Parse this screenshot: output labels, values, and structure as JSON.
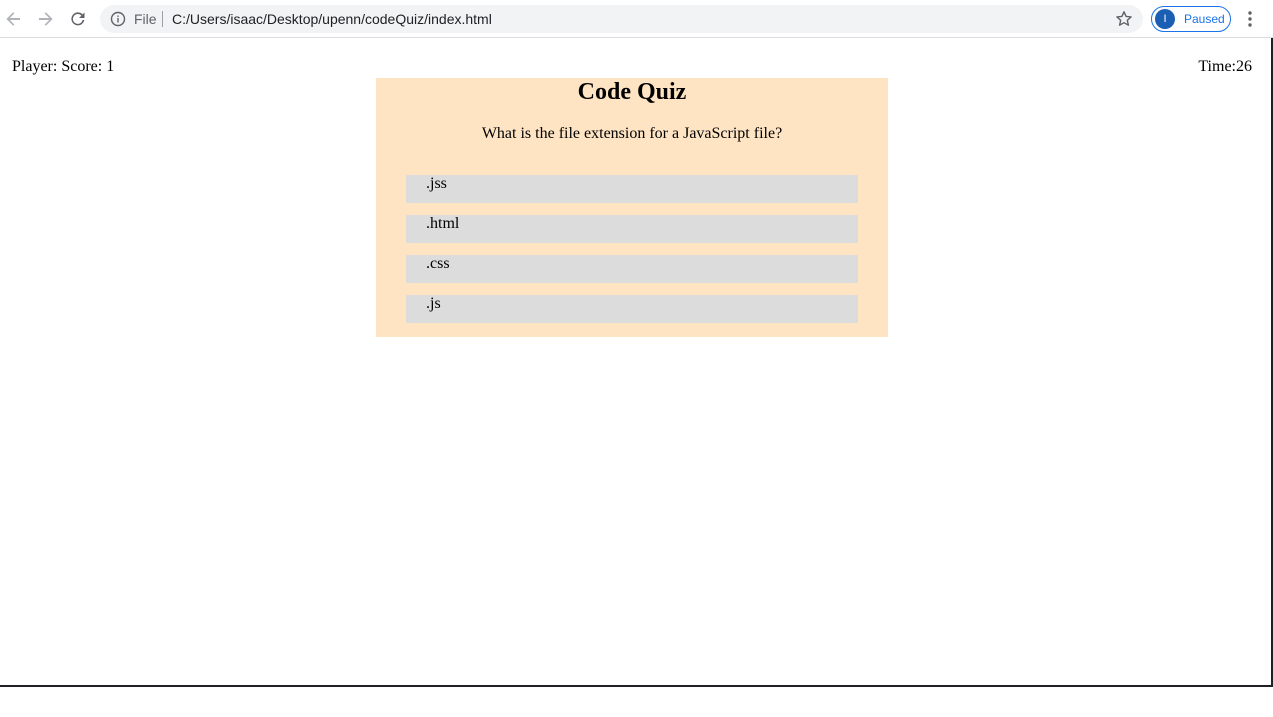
{
  "browser": {
    "back_icon": "arrow-left-icon",
    "forward_icon": "arrow-right-icon",
    "reload_icon": "reload-icon",
    "info_icon": "info-icon",
    "file_label": "File",
    "url": "C:/Users/isaac/Desktop/upenn/codeQuiz/index.html",
    "star_icon": "star-icon",
    "profile_initial": "I",
    "profile_status": "Paused",
    "menu_icon": "kebab-menu-icon",
    "accent_color": "#1a73e8"
  },
  "page": {
    "score_text": "Player: Score: 1",
    "timer_text": "Time:26",
    "quiz_title": "Code Quiz",
    "question": "What is the file extension for a JavaScript file?",
    "answers": [
      ".jss",
      ".html",
      ".css",
      ".js"
    ],
    "box_color": "#ffe4c4",
    "answer_color": "#dcdcdc"
  }
}
